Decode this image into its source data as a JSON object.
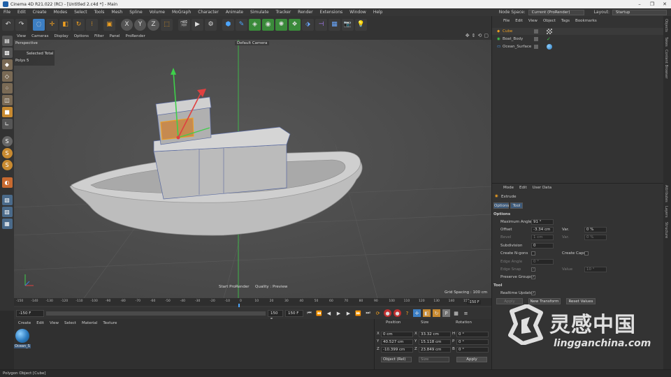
{
  "window": {
    "title": "Cinema 4D R21.022 (RC) - [Untitled 2.c4d *] - Main",
    "minimize": "–",
    "maximize": "❐",
    "close": "✕"
  },
  "menubar": {
    "items": [
      "File",
      "Edit",
      "Create",
      "Modes",
      "Select",
      "Tools",
      "Mesh",
      "Spline",
      "Volume",
      "MoGraph",
      "Character",
      "Animate",
      "Simulate",
      "Tracker",
      "Render",
      "Extensions",
      "Window",
      "Help"
    ],
    "node_space_label": "Node Space:",
    "node_space_value": "Current (ProRender)",
    "layout_label": "Layout:",
    "layout_value": "Startup"
  },
  "toolbar": {
    "axis_x": "X",
    "axis_y": "Y",
    "axis_z": "Z",
    "axis_p": "P"
  },
  "viewport": {
    "menu": [
      "View",
      "Cameras",
      "Display",
      "Options",
      "Filter",
      "Panel",
      "ProRender"
    ],
    "view_name": "Perspective",
    "camera": "Default Camera",
    "stats_header": "Selected Total",
    "stats_polys_label": "Polys",
    "stats_polys_value": "5",
    "start_prorender": "Start ProRender",
    "quality": "Quality : Preview",
    "grid_spacing": "Grid Spacing : 100 cm"
  },
  "timeline": {
    "ticks": [
      "-150",
      "-140",
      "-130",
      "-120",
      "-110",
      "-100",
      "-90",
      "-80",
      "-70",
      "-60",
      "-50",
      "-40",
      "-30",
      "-20",
      "-10",
      "0",
      "10",
      "20",
      "30",
      "40",
      "50",
      "60",
      "70",
      "80",
      "90",
      "100",
      "110",
      "120",
      "130",
      "140",
      "150"
    ],
    "current_frame_display": "-150 F",
    "start_field": "-150 F",
    "end_field_a": "150 F",
    "end_field_b": "150 F",
    "playhead_label": "0"
  },
  "material_manager": {
    "menu": [
      "Create",
      "Edit",
      "View",
      "Select",
      "Material",
      "Texture"
    ],
    "materials": [
      {
        "name": "Ocean_S"
      }
    ]
  },
  "coordinates": {
    "headers": {
      "position": "Position",
      "size": "Size",
      "rotation": "Rotation"
    },
    "rows": [
      {
        "axis": "X",
        "pos": "0 cm",
        "size_axis": "X",
        "size": "33.32 cm",
        "rot_axis": "H",
        "rot": "0 °"
      },
      {
        "axis": "Y",
        "pos": "40.527 cm",
        "size_axis": "Y",
        "size": "15.118 cm",
        "rot_axis": "P",
        "rot": "0 °"
      },
      {
        "axis": "Z",
        "pos": "-10.399 cm",
        "size_axis": "Z",
        "size": "23.849 cm",
        "rot_axis": "B",
        "rot": "0 °"
      }
    ],
    "mode_dropdown": "Object (Rel)",
    "size_dropdown": "Size",
    "apply": "Apply"
  },
  "object_manager": {
    "menu": [
      "File",
      "Edit",
      "View",
      "Object",
      "Tags",
      "Bookmarks"
    ],
    "objects": [
      {
        "name": "Cube"
      },
      {
        "name": "Boat_Body"
      },
      {
        "name": "Ocean_Surface"
      }
    ]
  },
  "attribute_manager": {
    "menu": [
      "Mode",
      "Edit",
      "User Data"
    ],
    "tool_name": "Extrude",
    "tabs": [
      "Options",
      "Tool"
    ],
    "section_options": "Options",
    "max_angle_label": "Maximum Angle",
    "max_angle_value": "91 °",
    "offset_label": "Offset",
    "offset_value": "-3.34 cm",
    "var_label": "Var.",
    "var_value": "0 %",
    "bevel_label": "Bevel",
    "bevel_value": "1 cm",
    "var2_label": "Var.",
    "var2_value": "0 %",
    "subdivision_label": "Subdivision",
    "subdivision_value": "0",
    "create_ngons_label": "Create N-gons",
    "create_caps_label": "Create Caps",
    "edge_angle_label": "Edge Angle",
    "edge_angle_value": "0 °",
    "edge_snap_label": "Edge Snap",
    "value_label": "Value",
    "value_value": "10 °",
    "preserve_groups_label": "Preserve Groups",
    "section_tool": "Tool",
    "realtime_update_label": "Realtime Update",
    "apply": "Apply",
    "new_transform": "New Transform",
    "reset_values": "Reset Values"
  },
  "right_tabs": [
    "Objects",
    "Takes",
    "Content Browser",
    "Attributes",
    "Layers",
    "Structure"
  ],
  "status": "Polygon Object [Cube]",
  "watermark": {
    "cn": "灵感中国",
    "url": "lingganchina.com"
  },
  "colors": {
    "accent_blue": "#3d7fc4",
    "axis_x": "#e04040",
    "axis_y": "#3ecf4a",
    "axis_z": "#3a7be0"
  }
}
